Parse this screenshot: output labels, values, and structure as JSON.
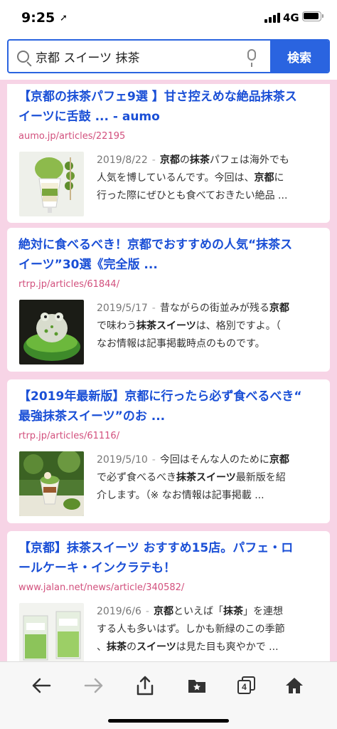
{
  "status": {
    "time": "9:25",
    "network": "4G"
  },
  "search": {
    "query": "京都 スイーツ 抹茶",
    "button_label": "検索"
  },
  "results": [
    {
      "title_line1": "【京都の抹茶パフェ9選 】甘さ控えめな絶品抹茶ス",
      "title_line2": "イーツに舌鼓 ... - aumo",
      "url": "aumo.jp/articles/22195",
      "date": "2019/8/22",
      "snippet_line1_pre": "",
      "snippet_line1_b1": "京都",
      "snippet_line1_mid": "の",
      "snippet_line1_b2": "抹茶",
      "snippet_line1_post": "パフェは海外でも",
      "snippet_line2_pre": "人気を博しているんです。今回は、",
      "snippet_line2_b": "京都",
      "snippet_line2_post": "に",
      "snippet_line3": "行った際にぜひとも食べておきたい絶品 ..."
    },
    {
      "title_line1": "絶対に食べるべき！京都でおすすめの人気“抹茶ス",
      "title_line2": "イーツ”30選《完全版 ...",
      "url": "rtrp.jp/articles/61844/",
      "date": "2019/5/17",
      "snippet_line1_pre": "昔ながらの街並みが残る",
      "snippet_line1_b": "京都",
      "snippet_line2_pre": "で味わう",
      "snippet_line2_b": "抹茶スイーツ",
      "snippet_line2_post": "は、格別ですよ。（",
      "snippet_line3": "なお情報は記事掲載時点のものです。"
    },
    {
      "title_line1": "【2019年最新版】京都に行ったら必ず食べるべき“",
      "title_line2": "最強抹茶スイーツ”のお ...",
      "url": "rtrp.jp/articles/61116/",
      "date": "2019/5/10",
      "snippet_line1_pre": "今回はそんな人のために",
      "snippet_line1_b": "京都",
      "snippet_line2_pre": "で必ず食べるべき",
      "snippet_line2_b": "抹茶スイーツ",
      "snippet_line2_post": "最新版を紹",
      "snippet_line3": "介します。（※ なお情報は記事掲載 ..."
    },
    {
      "title_line1": "【京都】抹茶スイーツ おすすめ15店。パフェ・ロ",
      "title_line2": "ールケーキ・インクラテも！",
      "url": "www.jalan.net/news/article/340582/",
      "date": "2019/6/6",
      "snippet_line1_b1": "京都",
      "snippet_line1_mid": "といえば「",
      "snippet_line1_b2": "抹茶",
      "snippet_line1_post": "」を連想",
      "snippet_line2": "する人も多いはず。しかも新緑のこの季節",
      "snippet_line3_pre": "、",
      "snippet_line3_b1": "抹茶",
      "snippet_line3_mid": "の",
      "snippet_line3_b2": "スイーツ",
      "snippet_line3_post": "は見た目も爽やかで ..."
    }
  ],
  "toolbar": {
    "tabs_count": "4"
  },
  "colors": {
    "accent": "#2a64e0",
    "title_link": "#1a4fd6",
    "url": "#d2507d",
    "background": "#f7d4e6"
  }
}
